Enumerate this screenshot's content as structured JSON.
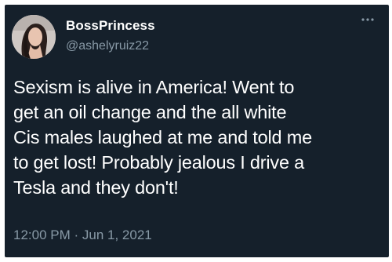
{
  "tweet": {
    "display_name": "BossPrincess",
    "handle": "@ashelyruiz22",
    "text": "Sexism is alive in America! Went to\nget an oil change and the all white\nCis males laughed at me and told me\nto get lost! Probably jealous I drive a\nTesla and they don't!",
    "timestamp": "12:00 PM · Jun 1, 2021",
    "avatar_icon": "profile-photo",
    "more_icon": "more-horizontal-icon"
  },
  "colors": {
    "background": "#15202b",
    "text_primary": "#ffffff",
    "text_secondary": "#8899a6"
  }
}
